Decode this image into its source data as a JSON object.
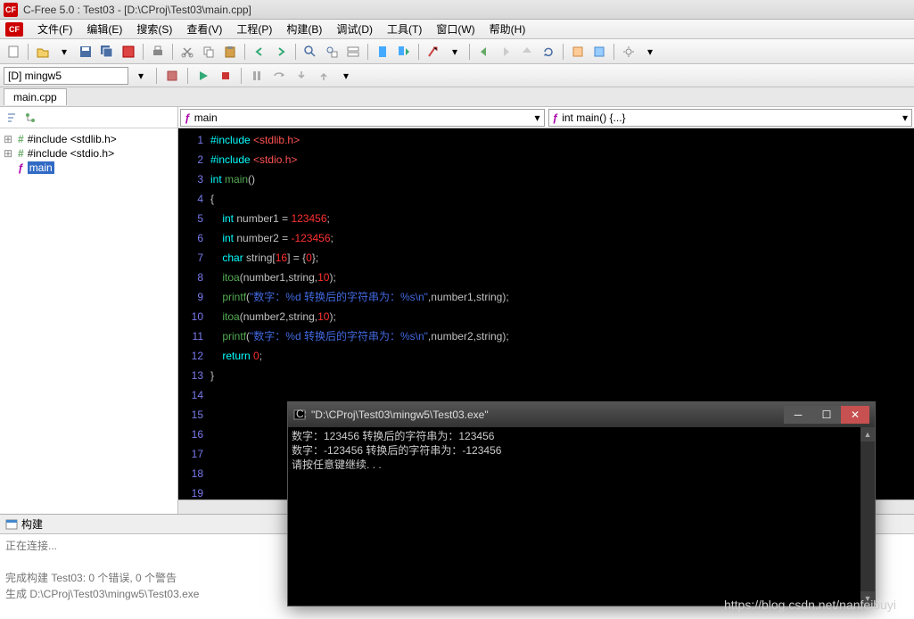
{
  "title": "C-Free 5.0 : Test03 - [D:\\CProj\\Test03\\main.cpp]",
  "menu": [
    "文件(F)",
    "编辑(E)",
    "搜索(S)",
    "查看(V)",
    "工程(P)",
    "构建(B)",
    "调试(D)",
    "工具(T)",
    "窗口(W)",
    "帮助(H)"
  ],
  "compiler": "[D] mingw5",
  "tab": "main.cpp",
  "sidebar_items": [
    {
      "icon": "inc",
      "label": "#include <stdlib.h>"
    },
    {
      "icon": "inc",
      "label": "#include <stdio.h>"
    },
    {
      "icon": "fn",
      "label": "main",
      "selected": true
    }
  ],
  "editor_dd1": "main",
  "editor_dd2": "int main() {...}",
  "code": {
    "lines": [
      {
        "n": 1,
        "html": "<span class='pp'>#include</span> <span class='pph'>&lt;stdlib.h&gt;</span>"
      },
      {
        "n": 2,
        "html": "<span class='pp'>#include</span> <span class='pph'>&lt;stdio.h&gt;</span>"
      },
      {
        "n": 3,
        "html": "<span class='kw'>int</span> <span class='fn'>main</span><span class='punct'>()</span>"
      },
      {
        "n": 4,
        "html": "<span class='punct'>{</span>"
      },
      {
        "n": 5,
        "html": "    <span class='kw'>int</span> <span class='ident'>number1</span> <span class='punct'>=</span> <span class='num'>123456</span><span class='punct'>;</span>"
      },
      {
        "n": 6,
        "html": "    <span class='kw'>int</span> <span class='ident'>number2</span> <span class='punct'>=</span> <span class='num'>-123456</span><span class='punct'>;</span>"
      },
      {
        "n": 7,
        "html": "    <span class='kw'>char</span> <span class='ident'>string</span><span class='punct'>[</span><span class='num'>16</span><span class='punct'>]</span> <span class='punct'>=</span> <span class='punct'>{</span><span class='num'>0</span><span class='punct'>};</span>"
      },
      {
        "n": 8,
        "html": "    <span class='fn'>itoa</span><span class='punct'>(</span><span class='ident'>number1</span><span class='punct'>,</span><span class='ident'>string</span><span class='punct'>,</span><span class='num'>10</span><span class='punct'>);</span>"
      },
      {
        "n": 9,
        "html": "    <span class='fn'>printf</span><span class='punct'>(</span><span class='str'>\"数字：%d 转换后的字符串为：%s\\n\"</span><span class='punct'>,</span><span class='ident'>number1</span><span class='punct'>,</span><span class='ident'>string</span><span class='punct'>);</span>"
      },
      {
        "n": 10,
        "html": "    <span class='fn'>itoa</span><span class='punct'>(</span><span class='ident'>number2</span><span class='punct'>,</span><span class='ident'>string</span><span class='punct'>,</span><span class='num'>10</span><span class='punct'>);</span>"
      },
      {
        "n": 11,
        "html": "    <span class='fn'>printf</span><span class='punct'>(</span><span class='str'>\"数字：%d 转换后的字符串为：%s\\n\"</span><span class='punct'>,</span><span class='ident'>number2</span><span class='punct'>,</span><span class='ident'>string</span><span class='punct'>);</span>"
      },
      {
        "n": 12,
        "html": "    <span class='kw'>return</span> <span class='num'>0</span><span class='punct'>;</span>"
      },
      {
        "n": 13,
        "html": "<span class='punct'>}</span>"
      },
      {
        "n": 14,
        "html": ""
      },
      {
        "n": 15,
        "html": ""
      },
      {
        "n": 16,
        "html": ""
      },
      {
        "n": 17,
        "html": ""
      },
      {
        "n": 18,
        "html": ""
      },
      {
        "n": 19,
        "html": ""
      }
    ]
  },
  "output": {
    "title": "构建",
    "lines": [
      "正在连接...",
      "",
      "完成构建 Test03: 0 个错误, 0 个警告",
      "生成 D:\\CProj\\Test03\\mingw5\\Test03.exe"
    ]
  },
  "console": {
    "title": "\"D:\\CProj\\Test03\\mingw5\\Test03.exe\"",
    "lines": [
      "数字：123456 转换后的字符串为：123456",
      "数字：-123456 转换后的字符串为：-123456",
      "请按任意键继续. . ."
    ]
  },
  "watermark": "https://blog.csdn.net/nanfeibuyi",
  "icons": {
    "app": "CF"
  }
}
